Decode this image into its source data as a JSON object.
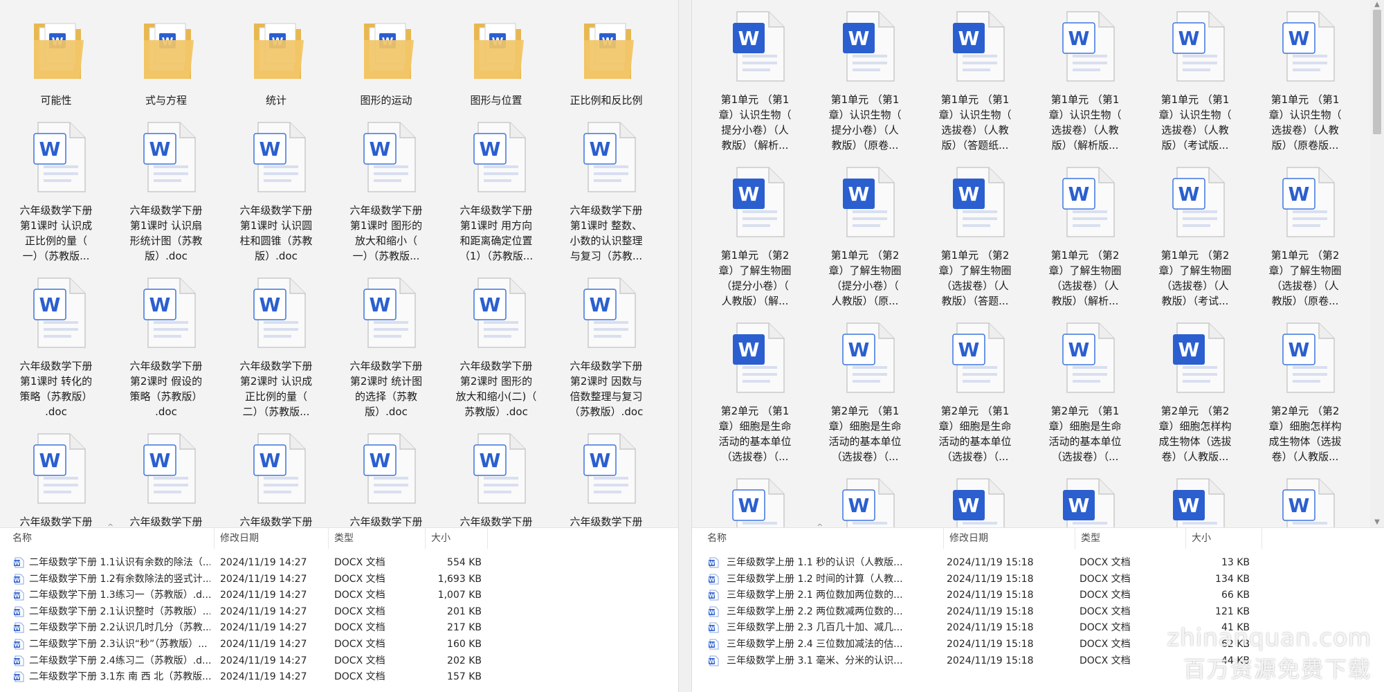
{
  "left": {
    "folders": [
      "可能性",
      "式与方程",
      "统计",
      "图形的运动",
      "图形与位置",
      "正比例和反比例"
    ],
    "files": [
      [
        "六年级数学下册",
        "第1课时 认识成",
        "正比例的量（",
        "一）（苏教版..."
      ],
      [
        "六年级数学下册",
        "第1课时 认识扇",
        "形统计图（苏教",
        "版）.doc"
      ],
      [
        "六年级数学下册",
        "第1课时 认识圆",
        "柱和圆锥（苏教",
        "版）.doc"
      ],
      [
        "六年级数学下册",
        "第1课时 图形的",
        "放大和缩小（",
        "一）（苏教版..."
      ],
      [
        "六年级数学下册",
        "第1课时 用方向",
        "和距离确定位置",
        "（1）（苏教版..."
      ],
      [
        "六年级数学下册",
        "第1课时 整数、",
        "小数的认识整理",
        "与复习（苏教..."
      ],
      [
        "六年级数学下册",
        "第1课时 转化的",
        "策略（苏教版）",
        ".doc"
      ],
      [
        "六年级数学下册",
        "第2课时 假设的",
        "策略（苏教版）",
        ".doc"
      ],
      [
        "六年级数学下册",
        "第2课时 认识成",
        "正比例的量（",
        "二）（苏教版..."
      ],
      [
        "六年级数学下册",
        "第2课时 统计图",
        "的选择（苏教",
        "版）.doc"
      ],
      [
        "六年级数学下册",
        "第2课时 图形的",
        "放大和缩小(二)（",
        "苏教版）.doc"
      ],
      [
        "六年级数学下册",
        "第2课时 因数与",
        "倍数整理与复习",
        "（苏教版）.doc"
      ],
      [
        "六年级数学下册"
      ],
      [
        "六年级数学下册"
      ],
      [
        "六年级数学下册"
      ],
      [
        "六年级数学下册"
      ],
      [
        "六年级数学下册"
      ],
      [
        "六年级数学下册"
      ]
    ],
    "columns": [
      "名称",
      "修改日期",
      "类型",
      "大小"
    ],
    "rows": [
      {
        "name": "二年级数学下册  1.1认识有余数的除法（...",
        "date": "2024/11/19 14:27",
        "type": "DOCX 文档",
        "size": "554 KB"
      },
      {
        "name": "二年级数学下册  1.2有余数除法的竖式计...",
        "date": "2024/11/19 14:27",
        "type": "DOCX 文档",
        "size": "1,693 KB"
      },
      {
        "name": "二年级数学下册  1.3练习一（苏教版）.d...",
        "date": "2024/11/19 14:27",
        "type": "DOCX 文档",
        "size": "1,007 KB"
      },
      {
        "name": "二年级数学下册  2.1认识整时（苏教版）...",
        "date": "2024/11/19 14:27",
        "type": "DOCX 文档",
        "size": "201 KB"
      },
      {
        "name": "二年级数学下册  2.2认识几时几分（苏教...",
        "date": "2024/11/19 14:27",
        "type": "DOCX 文档",
        "size": "217 KB"
      },
      {
        "name": "二年级数学下册  2.3认识“秒”（苏教版）...",
        "date": "2024/11/19 14:27",
        "type": "DOCX 文档",
        "size": "160 KB"
      },
      {
        "name": "二年级数学下册  2.4练习二（苏教版）.d...",
        "date": "2024/11/19 14:27",
        "type": "DOCX 文档",
        "size": "202 KB"
      },
      {
        "name": "二年级数学下册  3.1东 南 西 北（苏教版...",
        "date": "2024/11/19 14:27",
        "type": "DOCX 文档",
        "size": "157 KB"
      }
    ]
  },
  "right": {
    "files": [
      [
        "第1单元 （第1",
        "章）认识生物（",
        "提分小卷）（人",
        "教版）（解析..."
      ],
      [
        "第1单元 （第1",
        "章）认识生物（",
        "提分小卷）（人",
        "教版）（原卷..."
      ],
      [
        "第1单元 （第1",
        "章）认识生物（",
        "选拔卷）（人教",
        "版）（答题纸..."
      ],
      [
        "第1单元 （第1",
        "章）认识生物（",
        "选拔卷）（人教",
        "版）（解析版..."
      ],
      [
        "第1单元 （第1",
        "章）认识生物（",
        "选拔卷）（人教",
        "版）（考试版..."
      ],
      [
        "第1单元 （第1",
        "章）认识生物（",
        "选拔卷）（人教",
        "版）（原卷版..."
      ],
      [
        "第1单元 （第2",
        "章）了解生物圈",
        "（提分小卷）（",
        "人教版）（解..."
      ],
      [
        "第1单元 （第2",
        "章）了解生物圈",
        "（提分小卷）（",
        "人教版）（原..."
      ],
      [
        "第1单元 （第2",
        "章）了解生物圈",
        "（选拔卷）（人",
        "教版）（答题..."
      ],
      [
        "第1单元 （第2",
        "章）了解生物圈",
        "（选拔卷）（人",
        "教版）（解析..."
      ],
      [
        "第1单元 （第2",
        "章）了解生物圈",
        "（选拔卷）（人",
        "教版）（考试..."
      ],
      [
        "第1单元 （第2",
        "章）了解生物圈",
        "（选拔卷）（人",
        "教版）（原卷..."
      ],
      [
        "第2单元 （第1",
        "章）细胞是生命",
        "活动的基本单位",
        "（选拔卷）（..."
      ],
      [
        "第2单元 （第1",
        "章）细胞是生命",
        "活动的基本单位",
        "（选拔卷）（..."
      ],
      [
        "第2单元 （第1",
        "章）细胞是生命",
        "活动的基本单位",
        "（选拔卷）（..."
      ],
      [
        "第2单元 （第1",
        "章）细胞是生命",
        "活动的基本单位",
        "（选拔卷）（..."
      ],
      [
        "第2单元 （第2",
        "章）细胞怎样构",
        "成生物体（选拔",
        "卷）（人教版..."
      ],
      [
        "第2单元 （第2",
        "章）细胞怎样构",
        "成生物体（选拔",
        "卷）（人教版..."
      ],
      [],
      [],
      [],
      [],
      [],
      []
    ],
    "solid_icons": [
      0,
      1,
      2,
      6,
      7,
      8,
      12,
      16,
      20,
      21,
      22
    ],
    "columns": [
      "名称",
      "修改日期",
      "类型",
      "大小"
    ],
    "rows": [
      {
        "name": "三年级数学上册  1.1 秒的认识（人教版...",
        "date": "2024/11/19 15:18",
        "type": "DOCX 文档",
        "size": "13 KB"
      },
      {
        "name": "三年级数学上册  1.2 时间的计算（人教...",
        "date": "2024/11/19 15:18",
        "type": "DOCX 文档",
        "size": "134 KB"
      },
      {
        "name": "三年级数学上册  2.1 两位数加两位数的...",
        "date": "2024/11/19 15:18",
        "type": "DOCX 文档",
        "size": "66 KB"
      },
      {
        "name": "三年级数学上册  2.2 两位数减两位数的...",
        "date": "2024/11/19 15:18",
        "type": "DOCX 文档",
        "size": "121 KB"
      },
      {
        "name": "三年级数学上册  2.3 几百几十加、减几...",
        "date": "2024/11/19 15:18",
        "type": "DOCX 文档",
        "size": "41 KB"
      },
      {
        "name": "三年级数学上册  2.4 三位数加减法的估...",
        "date": "2024/11/19 15:18",
        "type": "DOCX 文档",
        "size": "62 KB"
      },
      {
        "name": "三年级数学上册  3.1 毫米、分米的认识...",
        "date": "2024/11/19 15:18",
        "type": "DOCX 文档",
        "size": "44 KB"
      }
    ]
  },
  "watermark": {
    "line1": "zhinanquan.com",
    "line2": "百万资源免费下载"
  },
  "colors": {
    "word_blue": "#2b5fcf",
    "word_blue_light": "#3a74e0",
    "folder": "#f2c568",
    "page": "#fafafa"
  }
}
